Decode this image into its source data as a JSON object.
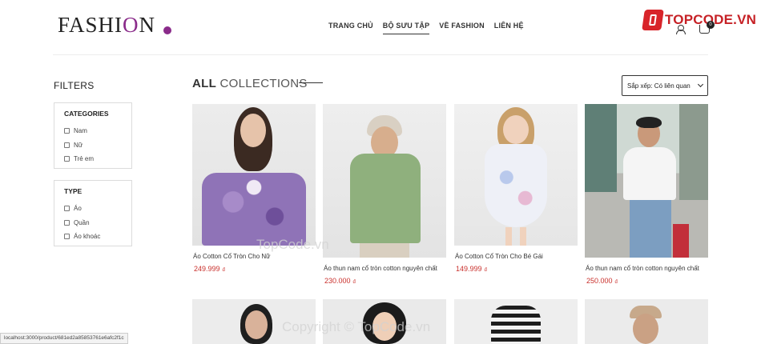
{
  "header": {
    "logo_main": "FASHI",
    "logo_accent": "O",
    "logo_end": "N",
    "nav": [
      "TRANG CHỦ",
      "BỘ SƯU TẬP",
      "VỀ FASHION",
      "LIÊN HỆ"
    ],
    "active_nav_index": 1,
    "brand_badge": "TOPCODE.VN",
    "cart_count": "0"
  },
  "sidebar": {
    "title": "FILTERS",
    "categories": {
      "heading": "CATEGORIES",
      "options": [
        "Nam",
        "Nữ",
        "Trẻ em"
      ]
    },
    "type": {
      "heading": "TYPE",
      "options": [
        "Áo",
        "Quần",
        "Áo khoác"
      ]
    }
  },
  "main": {
    "title_bold": "ALL",
    "title_light": "COLLECTIONS",
    "sort_label": "Sắp xếp: Có liên quan"
  },
  "products": [
    {
      "name": "Áo Cotton Cổ Tròn Cho Nữ",
      "price": "249.999",
      "currency": "đ"
    },
    {
      "name": "Áo thun nam cổ tròn cotton nguyên chất",
      "price": "230.000",
      "currency": "đ"
    },
    {
      "name": "Áo Cotton Cổ Tròn Cho Bé Gái",
      "price": "149.999",
      "currency": "đ"
    },
    {
      "name": "Áo thun nam cổ tròn cotton nguyên chất",
      "price": "250.000",
      "currency": "đ"
    }
  ],
  "watermarks": [
    "TopCode.vn",
    "Copyright © TopCode.vn"
  ],
  "status_url": "localhost:3000/product/681ed2a85853761e6afc2f1c",
  "colors": {
    "accent": "#8a2b8a",
    "price": "#c9302c",
    "brand": "#c62126"
  }
}
